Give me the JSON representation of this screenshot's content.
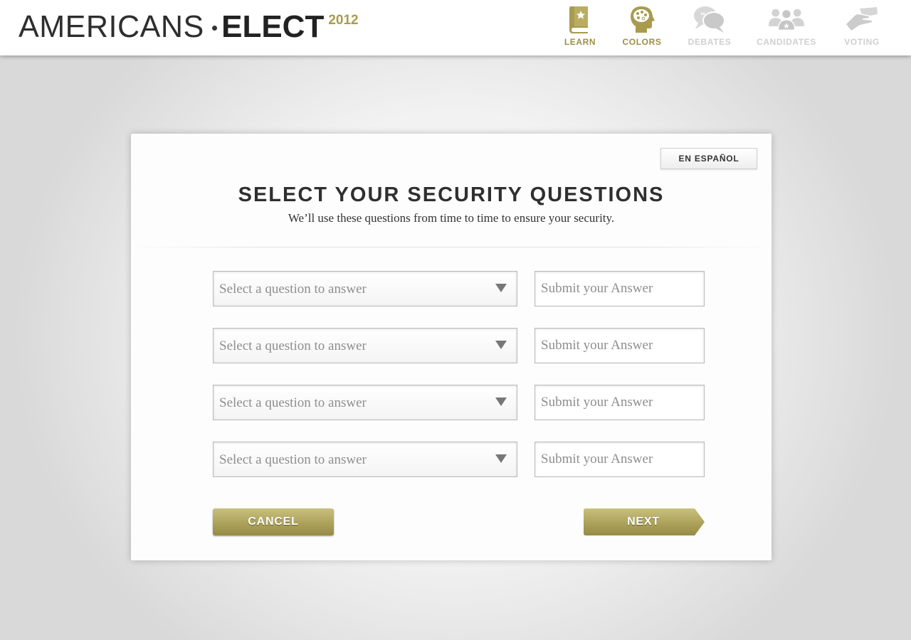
{
  "header": {
    "logo": {
      "word1": "AMERICANS",
      "word2": "ELECT",
      "year": "2012"
    },
    "nav": [
      {
        "label": "LEARN",
        "icon": "book-star-icon",
        "state": "active"
      },
      {
        "label": "COLORS",
        "icon": "palette-head-icon",
        "state": "active"
      },
      {
        "label": "DEBATES",
        "icon": "speech-bubbles-icon",
        "state": "inactive"
      },
      {
        "label": "CANDIDATES",
        "icon": "people-group-icon",
        "state": "inactive"
      },
      {
        "label": "VOTING",
        "icon": "hand-ballot-icon",
        "state": "inactive"
      }
    ]
  },
  "card": {
    "language_button": "EN ESPAÑOL",
    "title": "SELECT YOUR SECURITY QUESTIONS",
    "subtitle": "We’ll use these questions from time to time to ensure your security.",
    "questions": [
      {
        "select_placeholder": "Select a question to answer",
        "answer_placeholder": "Submit your Answer",
        "answer_value": ""
      },
      {
        "select_placeholder": "Select a question to answer",
        "answer_placeholder": "Submit your Answer",
        "answer_value": ""
      },
      {
        "select_placeholder": "Select a question to answer",
        "answer_placeholder": "Submit your Answer",
        "answer_value": ""
      },
      {
        "select_placeholder": "Select a question to answer",
        "answer_placeholder": "Submit your Answer",
        "answer_value": ""
      }
    ],
    "cancel_label": "CANCEL",
    "next_label": "NEXT"
  },
  "colors": {
    "accent_gold": "#a89b4e",
    "nav_inactive": "#cfcfcf",
    "button_gold": "#aca25a"
  }
}
